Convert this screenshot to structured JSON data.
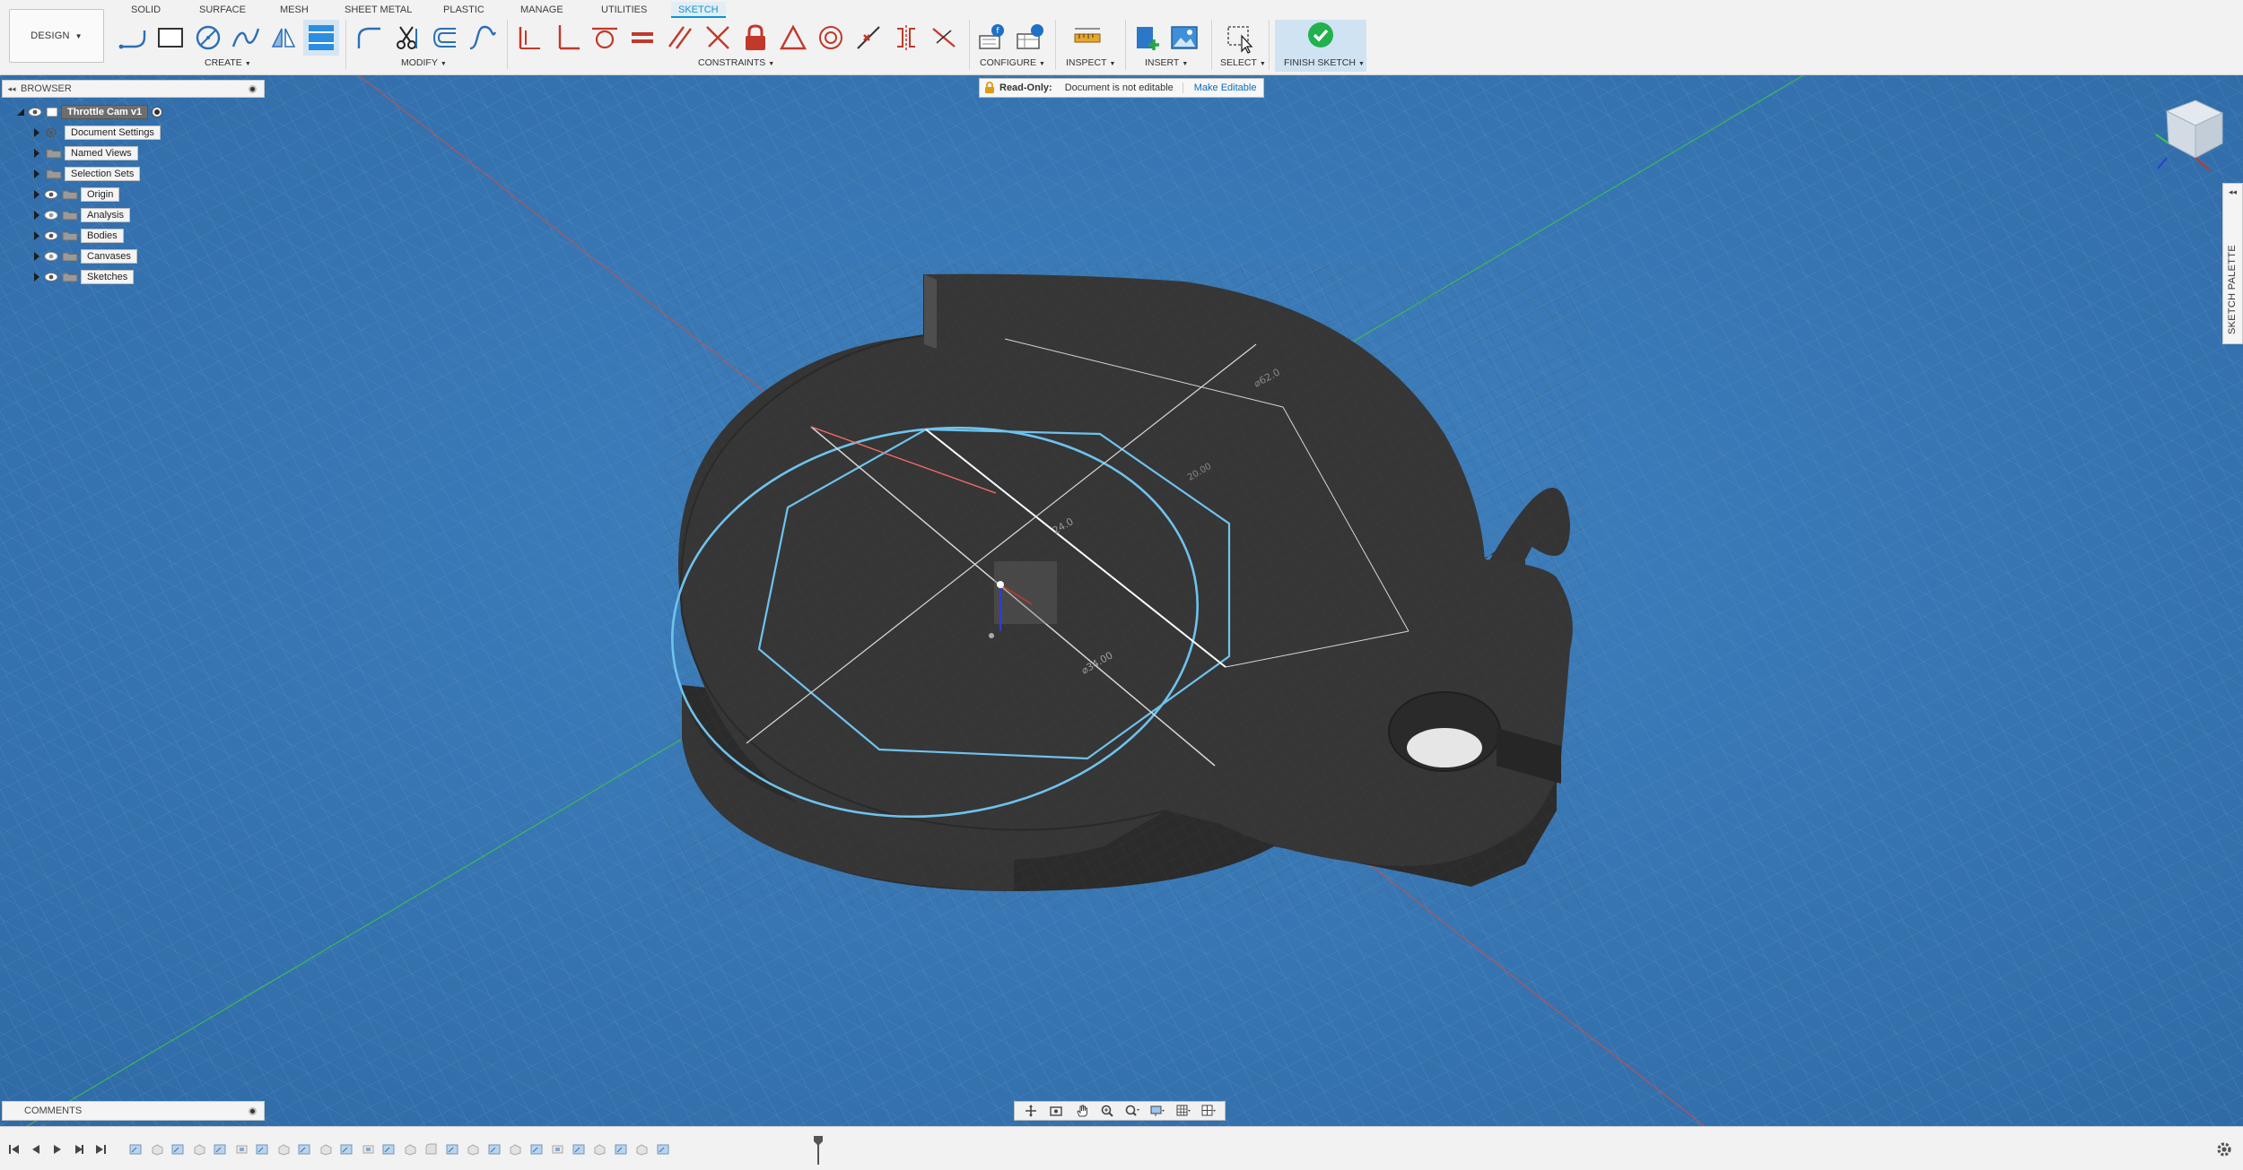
{
  "workspace": {
    "label": "DESIGN"
  },
  "tabs": [
    {
      "id": "solid",
      "label": "SOLID"
    },
    {
      "id": "surface",
      "label": "SURFACE"
    },
    {
      "id": "mesh",
      "label": "MESH"
    },
    {
      "id": "sheet-metal",
      "label": "SHEET METAL"
    },
    {
      "id": "plastic",
      "label": "PLASTIC"
    },
    {
      "id": "manage",
      "label": "MANAGE"
    },
    {
      "id": "utilities",
      "label": "UTILITIES"
    },
    {
      "id": "sketch",
      "label": "SKETCH",
      "active": true
    }
  ],
  "groups": {
    "create": "CREATE",
    "modify": "MODIFY",
    "constraints": "CONSTRAINTS",
    "configure": "CONFIGURE",
    "inspect": "INSPECT",
    "insert": "INSERT",
    "select": "SELECT",
    "finish": "FINISH SKETCH"
  },
  "browser": {
    "title": "BROWSER",
    "root": "Throttle Cam v1",
    "items": [
      {
        "label": "Document Settings",
        "icon": "gear-icon"
      },
      {
        "label": "Named Views",
        "icon": "folder-icon"
      },
      {
        "label": "Selection Sets",
        "icon": "folder-icon"
      },
      {
        "label": "Origin",
        "icon": "folder-icon"
      },
      {
        "label": "Analysis",
        "icon": "folder-icon"
      },
      {
        "label": "Bodies",
        "icon": "folder-icon"
      },
      {
        "label": "Canvases",
        "icon": "folder-icon"
      },
      {
        "label": "Sketches",
        "icon": "folder-icon"
      }
    ]
  },
  "banner": {
    "title": "Read-Only:",
    "message": "Document is not editable",
    "action": "Make Editable"
  },
  "sketch_palette": {
    "label": "SKETCH PALETTE"
  },
  "comments": {
    "title": "COMMENTS"
  },
  "colors": {
    "viewport": "#3a78b3",
    "sketch_line": "#6ec3ee",
    "accent": "#0696d7",
    "finish_check": "#22b14c"
  }
}
